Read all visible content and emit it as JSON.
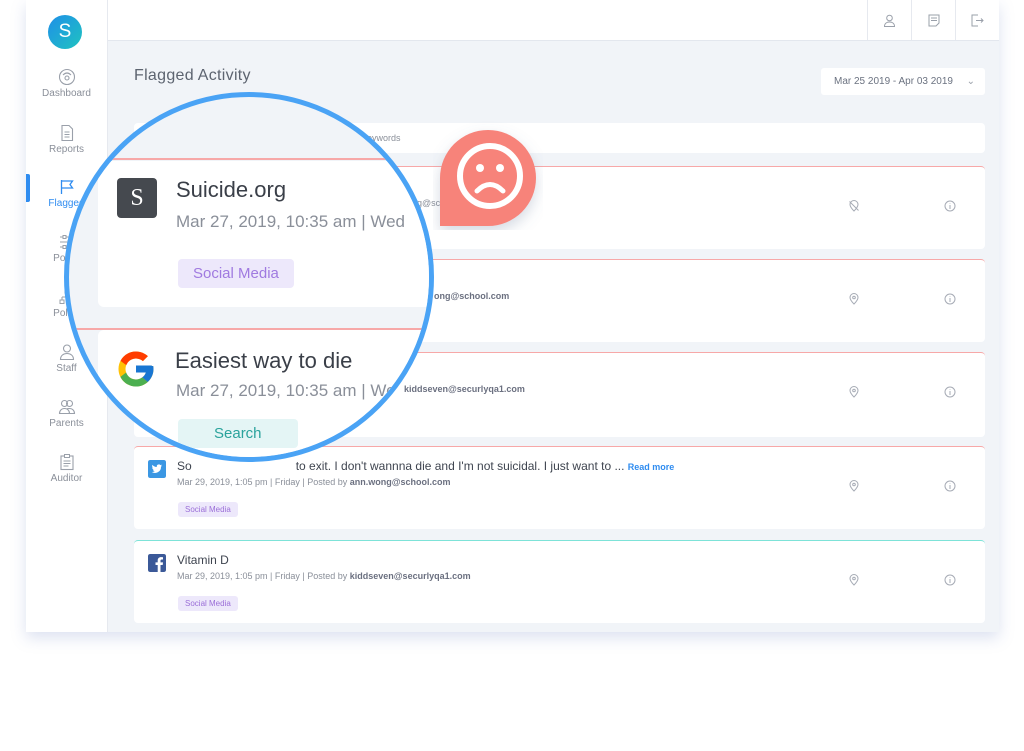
{
  "sidebar": {
    "avatar_initial": "S",
    "items": [
      {
        "label": "Dashboard",
        "icon": "gauge-icon"
      },
      {
        "label": "Reports",
        "icon": "document-icon"
      },
      {
        "label": "Flagged",
        "icon": "flag-icon",
        "active": true
      },
      {
        "label": "Policy",
        "icon": "sliders-icon"
      },
      {
        "label": "Policy",
        "icon": "hierarchy-icon"
      },
      {
        "label": "Staff",
        "icon": "person-icon"
      },
      {
        "label": "Parents",
        "icon": "people-icon"
      },
      {
        "label": "Auditor",
        "icon": "clipboard-icon"
      }
    ]
  },
  "topbar": {
    "buttons": [
      "user-icon",
      "notes-icon",
      "logout-icon"
    ]
  },
  "page": {
    "title": "Flagged Activity",
    "date_range": "Mar 25 2019 - Apr 03 2019",
    "table_header": {
      "keywords": "Keywords"
    }
  },
  "zoomed": [
    {
      "title": "Suicide.org",
      "meta": "Mar 27, 2019, 10:35 am | Wed",
      "tag": "Social Media",
      "source": "website"
    },
    {
      "title": "Easiest way to die",
      "meta": "Mar 27, 2019, 10:35 am | We",
      "tag": "Search",
      "source": "google"
    }
  ],
  "cards": [
    {
      "poster_partial": "ng@sc",
      "accent": "#f7a8a8"
    },
    {
      "poster_partial": "ong@school.com",
      "accent": "#f7a8a8"
    },
    {
      "poster_partial": "kiddseven@securlyqa1.com",
      "accent": "#f7a8a8"
    },
    {
      "source": "twitter",
      "title_partial": "to exit. I don't wannna die and I'm not suicidal. I just want to ...",
      "title_prefix": "So",
      "read_more": "Read more",
      "meta_prefix": "Mar 29, 2019, 1:05 pm | Friday | Posted by ",
      "poster": "ann.wong@school.com",
      "tag": "Social Media",
      "accent": "#f7a8a8"
    },
    {
      "source": "facebook",
      "title": "Vitamin D",
      "meta_prefix": "Mar 29, 2019, 1:05 pm | Friday | Posted by ",
      "poster": "kiddseven@securlyqa1.com",
      "tag": "Social Media",
      "accent": "#7de3d8"
    }
  ],
  "colors": {
    "accent": "#2f8cf0",
    "flag_red": "#f7a8a8",
    "sad_badge": "#f7837a",
    "lens_border": "#4aa3f5"
  }
}
